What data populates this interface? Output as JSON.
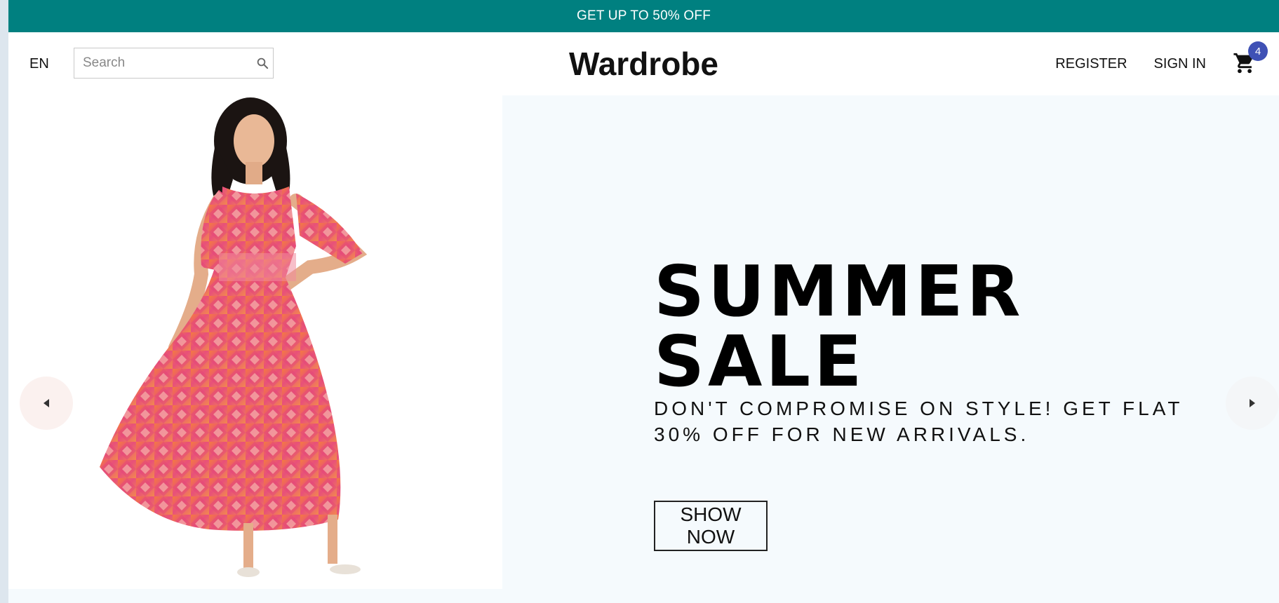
{
  "announcement": {
    "text": "GET UP TO 50% OFF"
  },
  "navbar": {
    "language": "EN",
    "search": {
      "placeholder": "Search",
      "value": ""
    },
    "logo": "Wardrobe",
    "register_label": "REGISTER",
    "signin_label": "SIGN IN",
    "cart": {
      "count": "4",
      "icon": "shopping-cart-icon"
    }
  },
  "slider": {
    "current_slide": {
      "image_alt": "woman in printed maxi dress",
      "title": "SUMMER SALE",
      "description": "DON'T COMPROMISE ON STYLE! GET FLAT 30% OFF FOR NEW ARRIVALS.",
      "button_label": "SHOW NOW",
      "background": "#f5fafd"
    },
    "prev_icon": "arrow-left-icon",
    "next_icon": "arrow-right-icon"
  },
  "colors": {
    "announcement_bg": "#008080",
    "badge_bg": "#3f51b5",
    "dress_pink": "#e8507a",
    "dress_orange": "#f47a42"
  }
}
